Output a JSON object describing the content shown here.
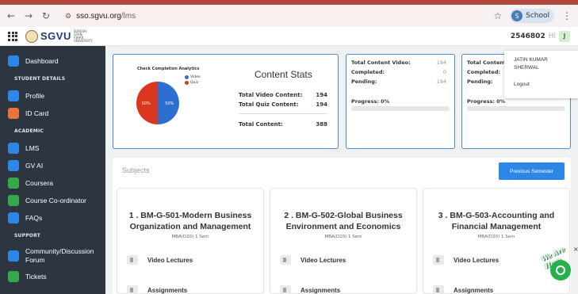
{
  "browser": {
    "url_host": "sso.sgvu.org",
    "url_path": "/lms",
    "profile_label": "School",
    "profile_initial": "S"
  },
  "header": {
    "logo_text": "SGVU",
    "logo_sub": "SURESH GYAN VIHAR UNIVERSITY",
    "user_id": "2546802",
    "user_greeting": "Hi",
    "user_initial": "J"
  },
  "user_menu": {
    "name": "JATIN KUMAR SHERWAL",
    "logout": "Logout"
  },
  "sidebar": {
    "items": [
      {
        "label": "Dashboard",
        "icon": "dashboard-icon",
        "color": "#2d87e8"
      },
      {
        "section": "STUDENT DETAILS"
      },
      {
        "label": "Profile",
        "icon": "profile-icon",
        "color": "#2d87e8"
      },
      {
        "label": "ID Card",
        "icon": "id-card-icon",
        "color": "#e8733d"
      },
      {
        "section": "ACADEMIC"
      },
      {
        "label": "LMS",
        "icon": "lms-icon",
        "color": "#2d87e8"
      },
      {
        "label": "GV AI",
        "icon": "gv-ai-icon",
        "color": "#2d87e8"
      },
      {
        "label": "Coursera",
        "icon": "coursera-icon",
        "color": "#37a84a"
      },
      {
        "label": "Course Co-ordinator",
        "icon": "coordinator-icon",
        "color": "#37a84a"
      },
      {
        "label": "FAQs",
        "icon": "faq-icon",
        "color": "#2d87e8"
      },
      {
        "section": "SUPPORT"
      },
      {
        "label": "Community/Discussion Forum",
        "icon": "community-icon",
        "color": "#2d87e8"
      },
      {
        "label": "Tickets",
        "icon": "tickets-icon",
        "color": "#37a84a"
      }
    ]
  },
  "analytics": {
    "chart_title": "Check Completion Analytics",
    "title": "Content Stats",
    "video_label": "Total Video Content:",
    "video_value": "194",
    "quiz_label": "Total Quiz Content:",
    "quiz_value": "194",
    "total_label": "Total Content:",
    "total_value": "388"
  },
  "chart_data": {
    "type": "pie",
    "title": "Check Completion Analytics",
    "categories": [
      "Video",
      "Quiz"
    ],
    "values": [
      50,
      50
    ],
    "data_labels": [
      "50%",
      "50%"
    ],
    "colors": [
      "#2d6fd0",
      "#d9371f"
    ],
    "legend": "top-right"
  },
  "video_card": {
    "title": "Total Content Video:",
    "title_value": "194",
    "completed_label": "Completed:",
    "completed_value": "0",
    "pending_label": "Pending:",
    "pending_value": "194",
    "progress_label": "Progress:",
    "progress_value": "0%",
    "progress_fraction": 0
  },
  "quiz_card": {
    "title": "Total Content",
    "completed_label": "Completed:",
    "pending_label": "Pending:",
    "progress_label": "Progress:",
    "progress_value": "0%",
    "progress_fraction": 0
  },
  "subjects": {
    "title": "Subjects",
    "prev_button": "Previous Semester",
    "cards": [
      {
        "name": "1 . BM-G-501-Modern Business Organization and Management",
        "meta": "MBA(D20) 1 Sem",
        "video": "Video Lectures",
        "assign": "Assignments"
      },
      {
        "name": "2 . BM-G-502-Global Business Environment and Economics",
        "meta": "MBA(D20) 1 Sem",
        "video": "Video Lectures",
        "assign": "Assignments"
      },
      {
        "name": "3 . BM-G-503-Accounting and Financial Management",
        "meta": "MBA(D20) 1 Sem",
        "video": "Video Lectures",
        "assign": "Assignments"
      }
    ]
  },
  "chat": {
    "badge_text": "We Are Here",
    "close": "×"
  }
}
